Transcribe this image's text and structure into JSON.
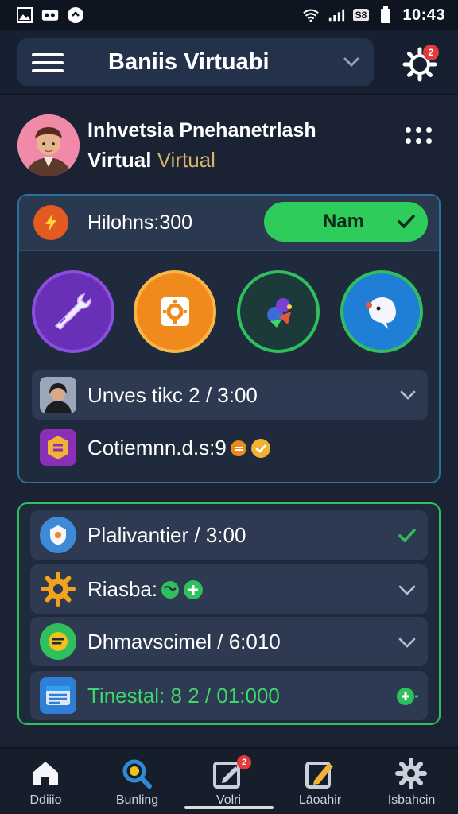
{
  "status_bar": {
    "time": "10:43",
    "battery_label": "S8",
    "icons": [
      "gallery-icon",
      "app-icon",
      "circle-icon",
      "wifi-icon",
      "signal-icon",
      "battery-icon"
    ]
  },
  "header": {
    "title": "Baniis Virtuabi",
    "notification_count": "2"
  },
  "profile": {
    "name": "Inhvetsia Pnehanetrlash",
    "subtitle_main": "Virtual",
    "subtitle_accent": "Virtual"
  },
  "balance": {
    "label": "Hilohns:300",
    "button_label": "Nam"
  },
  "app_icons": [
    "wrench-app-icon",
    "gear-app-icon",
    "shapes-app-icon",
    "ghost-app-icon"
  ],
  "card_rows": [
    {
      "text": "Unves tikc 2 / 3:00"
    },
    {
      "text": "Cotiemnn.d.s:9"
    }
  ],
  "list_rows": [
    {
      "text": "Plalivantier / 3:00"
    },
    {
      "text": "Riasba:"
    },
    {
      "text": "Dhmavscimel / 6:010"
    },
    {
      "text": "Tinestal: 8 2 / 01:000"
    }
  ],
  "bottom_nav": [
    {
      "label": "Ddiiio",
      "icon": "home-icon"
    },
    {
      "label": "Bunling",
      "icon": "search-icon"
    },
    {
      "label": "Volri",
      "icon": "edit-box-icon",
      "badge": "2"
    },
    {
      "label": "Lāoahir",
      "icon": "pencil-icon"
    },
    {
      "label": "Isbahcin",
      "icon": "gear-icon"
    }
  ],
  "colors": {
    "background": "#1a2233",
    "accent_green": "#2ecc5b",
    "accent_blue": "#2e6f9b",
    "gold_text": "#d6b56a",
    "badge_red": "#e33b3b"
  }
}
